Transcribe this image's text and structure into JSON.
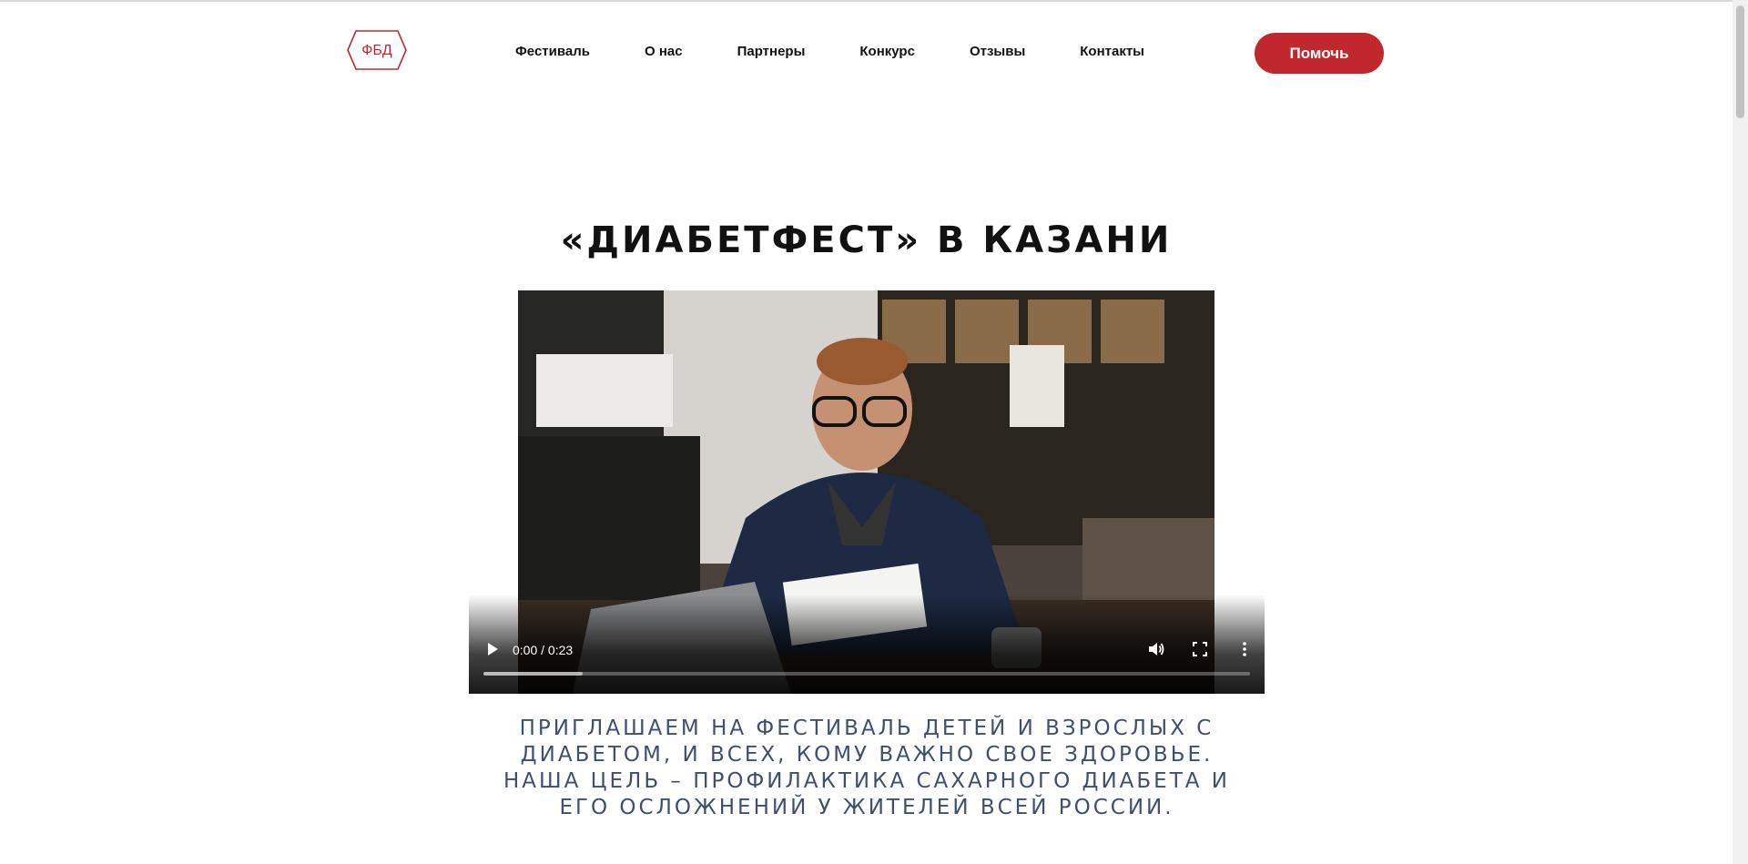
{
  "colors": {
    "accent": "#c0282d",
    "intro_text": "#3e4f72"
  },
  "header": {
    "logo_text": "ФБД",
    "nav": [
      {
        "label": "Фестиваль"
      },
      {
        "label": "О нас"
      },
      {
        "label": "Партнеры"
      },
      {
        "label": "Конкурс"
      },
      {
        "label": "Отзывы"
      },
      {
        "label": "Контакты"
      }
    ],
    "help_button": "Помочь"
  },
  "main": {
    "title": "«ДИАБЕТФЕСТ» В КАЗАНИ",
    "video": {
      "time": "0:00 / 0:23",
      "progress": 0.13,
      "icons": [
        "play-icon",
        "volume-icon",
        "fullscreen-icon",
        "more-options-icon"
      ]
    },
    "intro": "ПРИГЛАШАЕМ НА ФЕСТИВАЛЬ ДЕТЕЙ И ВЗРОСЛЫХ С ДИАБЕТОМ, И ВСЕХ, КОМУ ВАЖНО СВОЕ ЗДОРОВЬЕ. НАША ЦЕЛЬ – ПРОФИЛАКТИКА САХАРНОГО ДИАБЕТА И ЕГО ОСЛОЖНЕНИЙ У ЖИТЕЛЕЙ ВСЕЙ РОССИИ."
  }
}
